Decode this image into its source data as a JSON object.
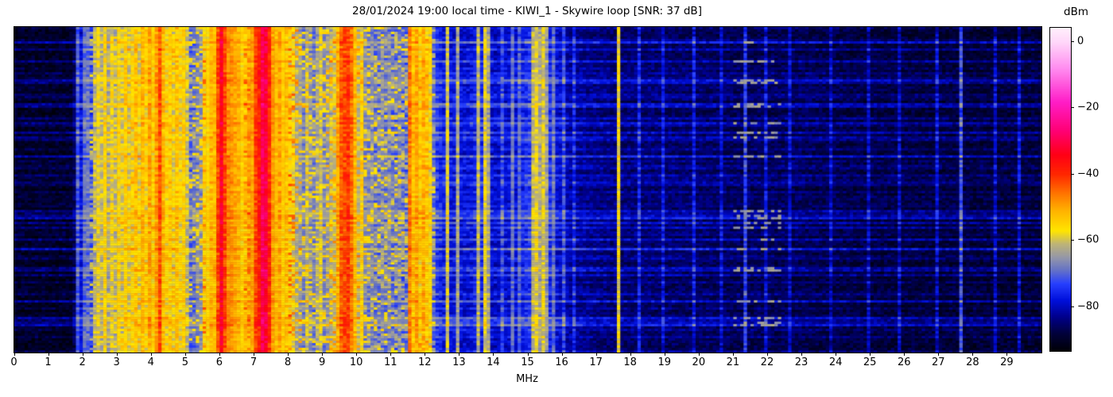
{
  "figure": {
    "background_color": "#ffffff",
    "text_color": "#000000"
  },
  "chart_data": {
    "type": "heatmap",
    "title": "28/01/2024 19:00 local time - KIWI_1 - Skywire loop [SNR: 37 dB]",
    "xlabel": "MHz",
    "ylabel": "",
    "x_range_mhz": [
      0,
      30
    ],
    "x_ticks": [
      0,
      1,
      2,
      3,
      4,
      5,
      6,
      7,
      8,
      9,
      10,
      11,
      12,
      13,
      14,
      15,
      16,
      17,
      18,
      19,
      20,
      21,
      22,
      23,
      24,
      25,
      26,
      27,
      28,
      29
    ],
    "y_ticks": [],
    "grid": {
      "bins": 300,
      "rows": 137,
      "bin_mhz": 0.1
    },
    "colorbar": {
      "label": "dBm",
      "vmax": 4.3,
      "vmin": -93.2,
      "ticks": [
        {
          "value": 0,
          "label": "0"
        },
        {
          "value": -20,
          "label": "−20"
        },
        {
          "value": -40,
          "label": "−40"
        },
        {
          "value": -60,
          "label": "−60"
        },
        {
          "value": -80,
          "label": "−80"
        }
      ]
    },
    "colormap_stops": [
      [
        -94,
        "#000000"
      ],
      [
        -88,
        "#02023c"
      ],
      [
        -83,
        "#00008c"
      ],
      [
        -78,
        "#0010dc"
      ],
      [
        -73,
        "#2840ff"
      ],
      [
        -69,
        "#6472c8"
      ],
      [
        -65,
        "#9698a8"
      ],
      [
        -61,
        "#beb478"
      ],
      [
        -57,
        "#ffe600"
      ],
      [
        -51,
        "#ffb400"
      ],
      [
        -46,
        "#ff7800"
      ],
      [
        -40,
        "#ff2800"
      ],
      [
        -34,
        "#ff0016"
      ],
      [
        -27,
        "#ff0073"
      ],
      [
        -18,
        "#ff1ec8"
      ],
      [
        -8,
        "#ff8cf0"
      ],
      [
        0,
        "#ffd7fa"
      ],
      [
        4.3,
        "#fff0fc"
      ]
    ],
    "noise_floor_profile_dbm": [
      [
        0,
        -91
      ],
      [
        1.7,
        -91
      ],
      [
        1.85,
        -82
      ],
      [
        2.1,
        -76
      ],
      [
        2.5,
        -72
      ],
      [
        3.0,
        -69
      ],
      [
        3.6,
        -66
      ],
      [
        4.4,
        -66
      ],
      [
        4.9,
        -68
      ],
      [
        5.15,
        -72
      ],
      [
        5.45,
        -68
      ],
      [
        5.6,
        -57
      ],
      [
        5.9,
        -52
      ],
      [
        6.1,
        -47
      ],
      [
        6.3,
        -49
      ],
      [
        6.55,
        -52
      ],
      [
        6.8,
        -62
      ],
      [
        6.95,
        -52
      ],
      [
        7.1,
        -45
      ],
      [
        7.2,
        -40
      ],
      [
        7.42,
        -42
      ],
      [
        7.55,
        -50
      ],
      [
        7.7,
        -55
      ],
      [
        8.0,
        -57
      ],
      [
        8.25,
        -64
      ],
      [
        8.45,
        -69
      ],
      [
        9.0,
        -70
      ],
      [
        9.3,
        -64
      ],
      [
        9.45,
        -56
      ],
      [
        9.75,
        -55
      ],
      [
        9.95,
        -58
      ],
      [
        10.15,
        -66
      ],
      [
        10.4,
        -71
      ],
      [
        11.0,
        -71
      ],
      [
        11.45,
        -72
      ],
      [
        11.6,
        -64
      ],
      [
        12.1,
        -64
      ],
      [
        12.3,
        -75
      ],
      [
        12.6,
        -79
      ],
      [
        13.3,
        -80
      ],
      [
        13.6,
        -76
      ],
      [
        14.0,
        -81
      ],
      [
        14.6,
        -80
      ],
      [
        15.1,
        -75
      ],
      [
        15.55,
        -75
      ],
      [
        15.85,
        -80
      ],
      [
        16.3,
        -84
      ],
      [
        17.5,
        -86
      ],
      [
        19.0,
        -86.5
      ],
      [
        21.0,
        -87.5
      ],
      [
        23.0,
        -88
      ],
      [
        25.0,
        -89
      ],
      [
        27.0,
        -89.5
      ],
      [
        30.0,
        -90
      ]
    ],
    "station_lines": [
      [
        1.85,
        -72
      ],
      [
        2.0,
        -70
      ],
      [
        2.15,
        -69
      ],
      [
        2.35,
        -62
      ],
      [
        2.45,
        -58
      ],
      [
        2.55,
        -61
      ],
      [
        2.65,
        -56
      ],
      [
        2.78,
        -63
      ],
      [
        2.88,
        -58
      ],
      [
        2.98,
        -62
      ],
      [
        3.08,
        -56
      ],
      [
        3.18,
        -60
      ],
      [
        3.28,
        -55
      ],
      [
        3.38,
        -59
      ],
      [
        3.48,
        -57
      ],
      [
        3.58,
        -53
      ],
      [
        3.68,
        -58
      ],
      [
        3.78,
        -52
      ],
      [
        3.88,
        -56
      ],
      [
        3.98,
        -50
      ],
      [
        4.08,
        -55
      ],
      [
        4.18,
        -49
      ],
      [
        4.27,
        -43,
        0.07
      ],
      [
        4.38,
        -53
      ],
      [
        4.48,
        -56
      ],
      [
        4.58,
        -54
      ],
      [
        4.68,
        -58
      ],
      [
        4.78,
        -53
      ],
      [
        4.88,
        -57
      ],
      [
        4.98,
        -55
      ],
      [
        5.08,
        -61
      ],
      [
        5.3,
        -69
      ],
      [
        5.42,
        -67
      ],
      [
        5.55,
        -55
      ],
      [
        5.65,
        -59
      ],
      [
        5.75,
        -52
      ],
      [
        5.85,
        -56
      ],
      [
        5.95,
        -49
      ],
      [
        6.07,
        -33,
        0.07
      ],
      [
        6.18,
        -46
      ],
      [
        6.32,
        -52
      ],
      [
        6.42,
        -55
      ],
      [
        6.5,
        -58
      ],
      [
        6.65,
        -56
      ],
      [
        6.75,
        -53
      ],
      [
        6.88,
        -50
      ],
      [
        7.08,
        -42,
        0.07
      ],
      [
        7.27,
        -29,
        0.1
      ],
      [
        7.36,
        -31,
        0.07
      ],
      [
        7.46,
        -46
      ],
      [
        7.58,
        -52
      ],
      [
        7.68,
        -56
      ],
      [
        7.78,
        -50
      ],
      [
        7.88,
        -55
      ],
      [
        7.98,
        -53
      ],
      [
        8.08,
        -57
      ],
      [
        8.18,
        -59
      ],
      [
        8.35,
        -65
      ],
      [
        8.52,
        -61
      ],
      [
        8.68,
        -66
      ],
      [
        8.82,
        -63
      ],
      [
        8.97,
        -60
      ],
      [
        9.12,
        -65
      ],
      [
        9.27,
        -62
      ],
      [
        9.42,
        -50
      ],
      [
        9.5,
        -44
      ],
      [
        9.62,
        -42
      ],
      [
        9.76,
        -41
      ],
      [
        9.88,
        -45
      ],
      [
        9.95,
        -52
      ],
      [
        10.12,
        -56
      ],
      [
        10.18,
        -63
      ],
      [
        10.45,
        -67
      ],
      [
        10.7,
        -69
      ],
      [
        10.95,
        -68
      ],
      [
        11.2,
        -70
      ],
      [
        11.56,
        -46
      ],
      [
        11.67,
        -53
      ],
      [
        11.77,
        -50
      ],
      [
        11.87,
        -55
      ],
      [
        11.97,
        -51
      ],
      [
        12.07,
        -54
      ],
      [
        12.15,
        -57
      ],
      [
        12.68,
        -59
      ],
      [
        12.9,
        -63
      ],
      [
        13.57,
        -61
      ],
      [
        13.7,
        -58
      ],
      [
        13.83,
        -63
      ],
      [
        14.25,
        -73
      ],
      [
        14.55,
        -69
      ],
      [
        14.78,
        -71
      ],
      [
        15.15,
        -61
      ],
      [
        15.25,
        -58
      ],
      [
        15.35,
        -63
      ],
      [
        15.45,
        -59
      ],
      [
        15.57,
        -64
      ],
      [
        15.78,
        -69
      ],
      [
        16.05,
        -73
      ],
      [
        16.35,
        -76
      ],
      [
        17.62,
        -57,
        0.05
      ],
      [
        18.2,
        -77
      ],
      [
        18.9,
        -79
      ],
      [
        19.8,
        -78
      ],
      [
        20.6,
        -80
      ],
      [
        21.3,
        -74
      ],
      [
        21.95,
        -79
      ],
      [
        22.6,
        -80
      ],
      [
        23.8,
        -81
      ],
      [
        24.9,
        -81
      ],
      [
        25.85,
        -81
      ],
      [
        26.9,
        -80
      ],
      [
        27.65,
        -73
      ],
      [
        28.6,
        -81
      ],
      [
        29.35,
        -80
      ]
    ],
    "speckle_regions": [
      {
        "range": [
          2.2,
          12.25
        ],
        "chance": 0.32,
        "boost_db": [
          6,
          15
        ]
      },
      {
        "range": [
          10.25,
          11.45
        ],
        "chance": 0.28,
        "level_dbm": [
          -68,
          -62
        ]
      },
      {
        "range": [
          21.0,
          22.4
        ],
        "chance": 0.5,
        "level_dbm": [
          -67,
          -62
        ],
        "only_on_boosted_rows": true
      }
    ],
    "row_streaks": {
      "weak_fraction": 0.3,
      "strong_fraction": 0.06,
      "boost_db": [
        2,
        11.5
      ]
    }
  }
}
